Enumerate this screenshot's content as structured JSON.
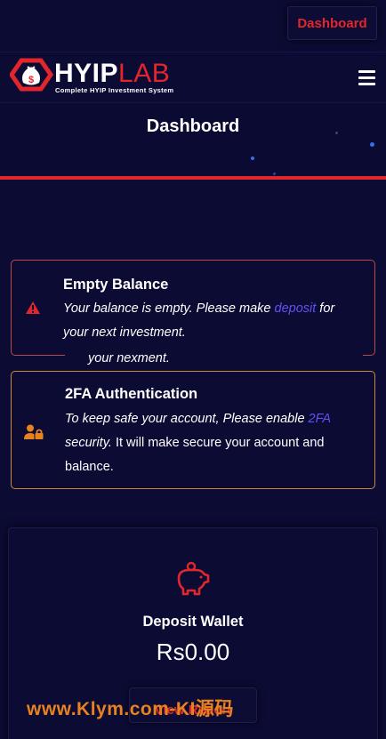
{
  "header": {
    "dashboard_button": "Dashboard",
    "brand_primary": "HYIP",
    "brand_secondary": "LAB",
    "tagline": "Complete HYIP Investment System"
  },
  "banner": {
    "title": "Dashboard"
  },
  "alerts": [
    {
      "title": "Empty Balance",
      "text_before": "Your balance is empty. Please make ",
      "link": "deposit",
      "text_after": " for your next investment.",
      "overflow_text": "your nexment.",
      "icon": "warning-icon",
      "color": "#b84a45"
    },
    {
      "title": "2FA Authentication",
      "text_before": "To keep safe your account, Please enable ",
      "link": "2FA",
      "text_mid": "security.",
      "text_after": " It will make secure your account and balance.",
      "icon": "user-lock-icon",
      "color": "#c98a3c"
    }
  ],
  "wallet": {
    "icon": "piggy-bank-icon",
    "label": "Deposit Wallet",
    "amount": "Rs0.00",
    "button": "View Report"
  },
  "watermark": "www.Klym.com-KI源码",
  "colors": {
    "background": "#0c0b34",
    "accent": "#e3262b",
    "link": "#5f52f5"
  }
}
